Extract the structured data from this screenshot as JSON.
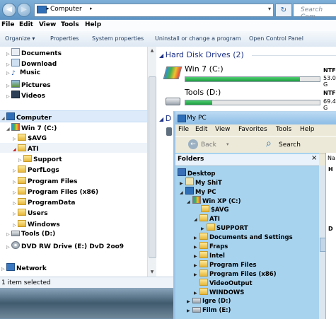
{
  "address": {
    "crumb": "Computer",
    "search_placeholder": "Search Com"
  },
  "menu": [
    "File",
    "Edit",
    "View",
    "Tools",
    "Help"
  ],
  "toolbar": {
    "organize": "Organize ▾",
    "properties": "Properties",
    "system_properties": "System properties",
    "uninstall": "Uninstall or change a program",
    "control_panel": "Open Control Panel"
  },
  "nav": {
    "documents": "Documents",
    "download": "Download",
    "music": "Music",
    "pictures": "Pictures",
    "videos": "Videos",
    "computer": "Computer",
    "win7": "Win 7 (C:)",
    "avg": "$AVG",
    "ati": "ATI",
    "support": "Support",
    "perflogs": "PerfLogs",
    "program_files": "Program Files",
    "program_files_x86": "Program Files (x86)",
    "programdata": "ProgramData",
    "users": "Users",
    "windows": "Windows",
    "tools": "Tools (D:)",
    "dvd": "DVD RW Drive (E:) DvD 2oo9",
    "network": "Network"
  },
  "content": {
    "group": "Hard Disk Drives (2)",
    "d1_name": "Win 7 (C:)",
    "d1_fs": "NTFS",
    "d1_size": "53.0 G",
    "d1_used": 0.85,
    "d2_name": "Tools (D:)",
    "d2_fs": "NTFS",
    "d2_size": "69.4 G",
    "d2_used": 0.2,
    "group2_initial": "D"
  },
  "status": {
    "text": "1 item selected"
  },
  "xp": {
    "title": "My PC",
    "menu": [
      "File",
      "Edit",
      "View",
      "Favorites",
      "Tools",
      "Help"
    ],
    "back": "Back",
    "search": "Search",
    "folders_label": "Folders",
    "close": "×",
    "tree": {
      "desktop": "Desktop",
      "myshit": "My ShiT",
      "mypc": "My PC",
      "winxp": "Win XP (C:)",
      "avg": "$AVG",
      "ati": "ATI",
      "support": "SUPPORT",
      "docs": "Documents and Settings",
      "fraps": "Fraps",
      "intel": "Intel",
      "pf": "Program Files",
      "pf86": "Program Files (x86)",
      "video": "VideoOutput",
      "windows": "WINDOWS",
      "igre": "Igre (D:)",
      "film": "Film (E:)"
    },
    "right": {
      "name": "Na",
      "h": "H",
      "d": "D"
    }
  },
  "colors": {
    "accent": "#1c5ea5",
    "selection": "#dceaf9",
    "xp_folders_bg": "#a7d3ef"
  }
}
